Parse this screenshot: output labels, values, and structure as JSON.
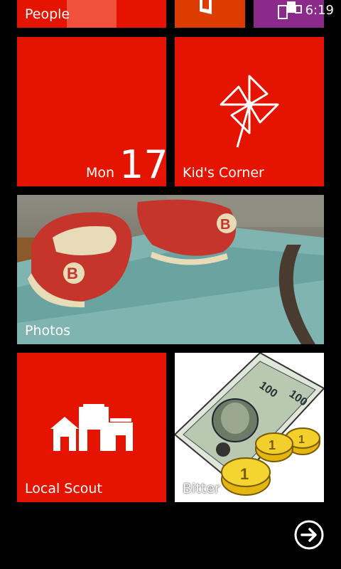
{
  "status": {
    "time": "6:19"
  },
  "tiles": {
    "people": {
      "label": "People"
    },
    "calendar": {
      "day": "Mon",
      "date": "17"
    },
    "kids_corner": {
      "label": "Kid's Corner"
    },
    "photos": {
      "label": "Photos"
    },
    "local_scout": {
      "label": "Local Scout"
    },
    "bitter": {
      "label": "Bitter"
    }
  },
  "colors": {
    "accent": "#e51400",
    "office_orange": "#dc3c00",
    "messaging_purple": "#8c2a8c"
  }
}
